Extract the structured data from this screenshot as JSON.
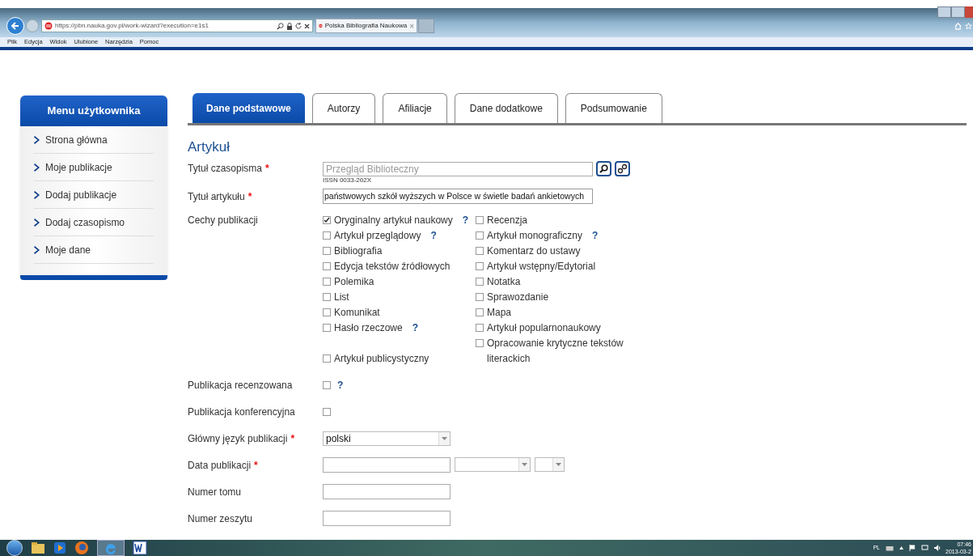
{
  "browser": {
    "address": "https://pbn.nauka.gov.pl/work-wizard?execution=e1s1",
    "tab_title": "Polska Bibliografia Naukowa",
    "tab_close": "×",
    "menu": [
      "Plik",
      "Edycja",
      "Widok",
      "Ulubione",
      "Narzędzia",
      "Pomoc"
    ]
  },
  "sidebar": {
    "title": "Menu użytkownika",
    "items": [
      "Strona główna",
      "Moje publikacje",
      "Dodaj publikacje",
      "Dodaj czasopismo",
      "Moje dane"
    ]
  },
  "tabs": [
    {
      "label": "Dane podstawowe",
      "selected": true
    },
    {
      "label": "Autorzy",
      "selected": false
    },
    {
      "label": "Afiliacje",
      "selected": false
    },
    {
      "label": "Dane dodatkowe",
      "selected": false
    },
    {
      "label": "Podsumowanie",
      "selected": false
    }
  ],
  "heading": "Artykuł",
  "journal": {
    "label": "Tytuł czasopisma",
    "required_mark": "*",
    "placeholder": "Przegląd Biblioteczny",
    "issn": "ISSN 0033-202X"
  },
  "article_title": {
    "label": "Tytuł artykułu",
    "required_mark": "*",
    "value": "państwowych szkół wyższych w Polsce w świetle badań ankietowych"
  },
  "features": {
    "label": "Cechy publikacji",
    "left": [
      {
        "label": "Oryginalny artykuł naukowy",
        "checked": true,
        "help": "?"
      },
      {
        "label": "Artykuł przeglądowy",
        "checked": false,
        "help": "?"
      },
      {
        "label": "Bibliografia",
        "checked": false
      },
      {
        "label": "Edycja tekstów źródłowych",
        "checked": false
      },
      {
        "label": "Polemika",
        "checked": false
      },
      {
        "label": "List",
        "checked": false
      },
      {
        "label": "Komunikat",
        "checked": false
      },
      {
        "label": "Hasło rzeczowe",
        "checked": false,
        "help": "?"
      },
      {
        "label": "Artykuł publicystyczny",
        "checked": false
      }
    ],
    "right": [
      {
        "label": "Recenzja",
        "checked": false
      },
      {
        "label": "Artykuł monograficzny",
        "checked": false,
        "help": "?"
      },
      {
        "label": "Komentarz do ustawy",
        "checked": false
      },
      {
        "label": "Artykuł wstępny/Edytorial",
        "checked": false
      },
      {
        "label": "Notatka",
        "checked": false
      },
      {
        "label": "Sprawozdanie",
        "checked": false
      },
      {
        "label": "Mapa",
        "checked": false
      },
      {
        "label": "Artykuł popularnonaukowy",
        "checked": false
      },
      {
        "label": "Opracowanie krytyczne tekstów literackich",
        "checked": false
      }
    ]
  },
  "fields": [
    {
      "kind": "checkbox",
      "label": "Publikacja recenzowana",
      "checked": false,
      "help": "?"
    },
    {
      "kind": "checkbox",
      "label": "Publikacja konferencyjna",
      "checked": false
    },
    {
      "kind": "select",
      "label": "Główny język publikacji",
      "required_mark": "*",
      "value": "polski"
    },
    {
      "kind": "date",
      "label": "Data publikacji",
      "required_mark": "*"
    },
    {
      "kind": "text",
      "label": "Numer tomu"
    },
    {
      "kind": "text",
      "label": "Numer zeszytu"
    }
  ],
  "taskbar": {
    "language": "PL",
    "time": "07:46",
    "date": "2013-03-2"
  }
}
